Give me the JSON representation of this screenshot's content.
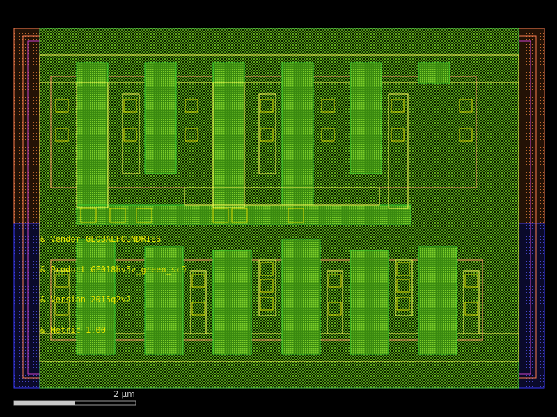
{
  "layout_view": {
    "colors": {
      "background": "#000000",
      "nwell": "#ff7f50",
      "pwell": "#3a3aff",
      "diff": "#aaff00",
      "poly": "#33cc33",
      "metal1": "#ffff55",
      "contact": "#d8d800",
      "text": "#e6e600"
    },
    "annotations": [
      "& Vendor GLOBALFOUNDRIES",
      "& Product GF018hv5v_green_sc9",
      "& Version 2015q2v2",
      "& Metric 1.00"
    ],
    "scale_bar": {
      "label": "2  µm"
    }
  }
}
